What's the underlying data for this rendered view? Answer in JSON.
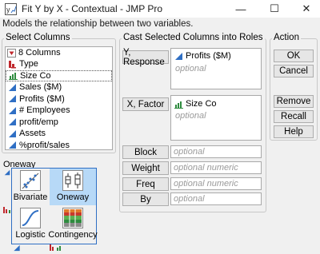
{
  "window": {
    "title": "Fit Y by X - Contextual - JMP Pro",
    "minimize_glyph": "—",
    "maximize_glyph": "☐",
    "close_glyph": "✕"
  },
  "subtitle": "Models the relationship between two variables.",
  "select_columns": {
    "title": "Select Columns",
    "count_label": "8 Columns",
    "columns": [
      {
        "label": "Type",
        "icon": "nominal-icon"
      },
      {
        "label": "Size Co",
        "icon": "ordinal-icon",
        "selected": true
      },
      {
        "label": "Sales ($M)",
        "icon": "continuous-icon"
      },
      {
        "label": "Profits ($M)",
        "icon": "continuous-icon"
      },
      {
        "label": "# Employees",
        "icon": "continuous-icon"
      },
      {
        "label": "profit/emp",
        "icon": "continuous-icon"
      },
      {
        "label": "Assets",
        "icon": "continuous-icon"
      },
      {
        "label": "%profit/sales",
        "icon": "continuous-icon"
      }
    ]
  },
  "cast": {
    "title": "Cast Selected Columns into Roles",
    "y_button": "Y, Response",
    "y_value": "Profits ($M)",
    "y_optional": "optional",
    "x_button": "X, Factor",
    "x_value": "Size Co",
    "x_optional": "optional",
    "block_button": "Block",
    "block_placeholder": "optional",
    "weight_button": "Weight",
    "weight_placeholder": "optional numeric",
    "freq_button": "Freq",
    "freq_placeholder": "optional numeric",
    "by_button": "By",
    "by_placeholder": "optional"
  },
  "action": {
    "title": "Action",
    "ok": "OK",
    "cancel": "Cancel",
    "remove": "Remove",
    "recall": "Recall",
    "help": "Help"
  },
  "analysis": {
    "current": "Oneway",
    "tiles": [
      {
        "label": "Bivariate"
      },
      {
        "label": "Oneway",
        "active": true
      },
      {
        "label": "Logistic"
      },
      {
        "label": "Contingency"
      }
    ]
  },
  "colors": {
    "nominal": "#c0282d",
    "continuous": "#2f6fc4",
    "tile_active": "#b7d9f7"
  }
}
